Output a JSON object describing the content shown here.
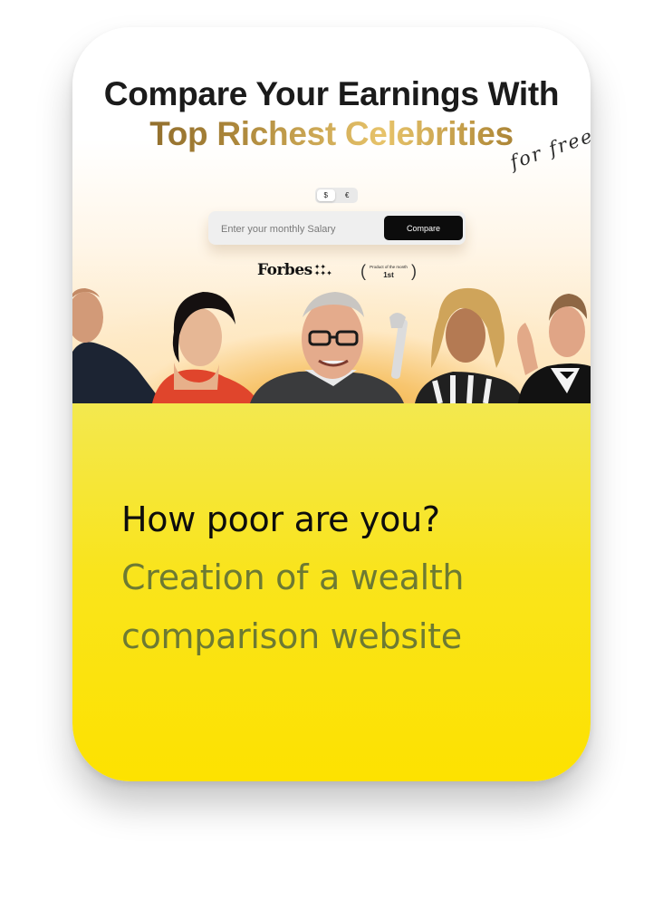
{
  "hero": {
    "title_line1": "Compare Your Earnings With",
    "title_line2": "Top Richest Celebrities",
    "scribble": "for free"
  },
  "currency": {
    "options": [
      "$",
      "€"
    ],
    "selected": "$"
  },
  "salary_form": {
    "placeholder": "Enter your monthly Salary",
    "button_label": "Compare"
  },
  "badges": {
    "forbes_logo": "Forbes",
    "award_small": "Product of the month",
    "award_rank": "1st"
  },
  "celebrities": [
    {
      "icon": "celebrity-portrait-1"
    },
    {
      "icon": "celebrity-portrait-2"
    },
    {
      "icon": "celebrity-portrait-3"
    },
    {
      "icon": "celebrity-portrait-4"
    },
    {
      "icon": "celebrity-portrait-5"
    }
  ],
  "case_study": {
    "headline": "How poor are you?",
    "description": "Creation of a wealth comparison website"
  },
  "colors": {
    "accent_yellow": "#fde200",
    "gold": "#a98439",
    "subtitle_olive": "#6d7a33",
    "button_dark": "#0c0c0c"
  }
}
